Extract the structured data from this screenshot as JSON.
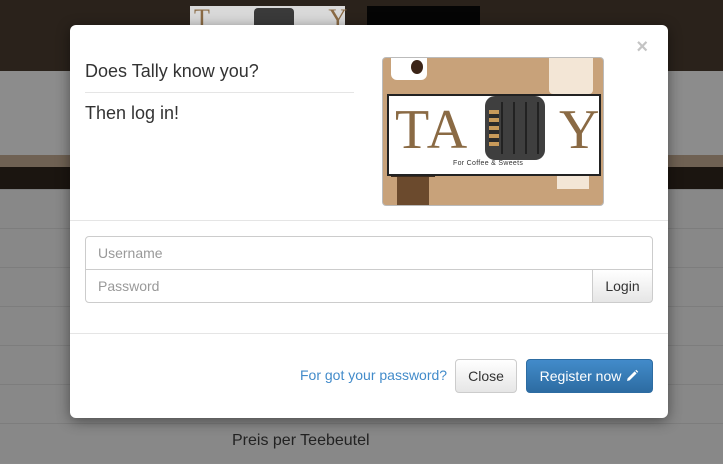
{
  "background": {
    "footer_text": "Preis per Teebeutel"
  },
  "modal": {
    "close_symbol": "×",
    "title_line1": "Does Tally know you?",
    "title_line2": "Then log in!",
    "logo": {
      "word_left": "TA",
      "word_right": "Y",
      "tagline": "For Coffee & Sweets"
    },
    "form": {
      "username_placeholder": "Username",
      "password_placeholder": "Password",
      "login_label": "Login"
    },
    "footer": {
      "forgot_label": "For got your password?",
      "close_label": "Close",
      "register_label": "Register now",
      "register_icon": "pencil-icon"
    }
  },
  "colors": {
    "primary": "#428bca",
    "link": "#428bca",
    "logo_brown": "#8a6a44"
  }
}
